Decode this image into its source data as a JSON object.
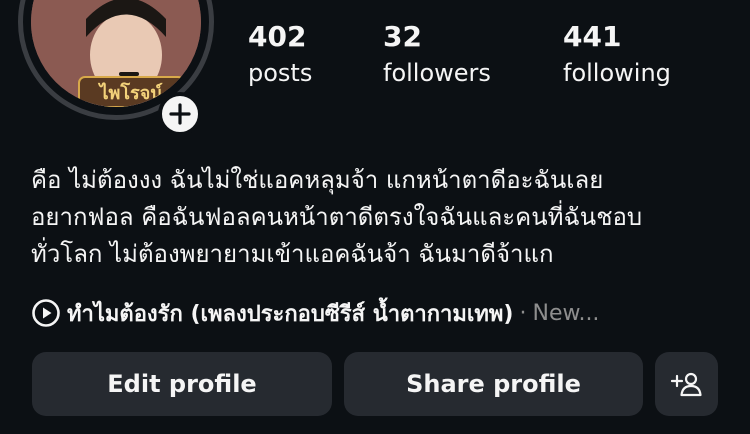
{
  "profile": {
    "avatar_caption": "ไพโรจน์",
    "stats": {
      "posts_count": "402",
      "posts_label": "posts",
      "followers_count": "32",
      "followers_label": "followers",
      "following_count": "441",
      "following_label": "following"
    },
    "bio_lines": [
      "คือ ไม่ต้องงง ฉันไม่ใช่แอคหลุมจ้า แกหน้าตาดีอะฉันเลย",
      "อยากฟอล คือฉันฟอลคนหน้าตาดีตรงใจฉันและคนที่ฉันชอบ",
      "ทั่วโลก ไม่ต้องพยายามเข้าแอคฉันจ้า ฉันมาดีจ้าแก"
    ],
    "music": {
      "title": "ทำไมต้องรัก (เพลงประกอบซีรีส์ น้ำตากามเทพ)",
      "separator": "·",
      "artist": "New..."
    }
  },
  "actions": {
    "edit_label": "Edit profile",
    "share_label": "Share profile"
  },
  "icons": {
    "add": "plus-icon",
    "play": "play-circle-icon",
    "suggest": "add-person-icon"
  },
  "colors": {
    "background": "#0c1014",
    "button": "#262a30",
    "text": "#f5f5f5",
    "muted": "#8e8e8e"
  }
}
